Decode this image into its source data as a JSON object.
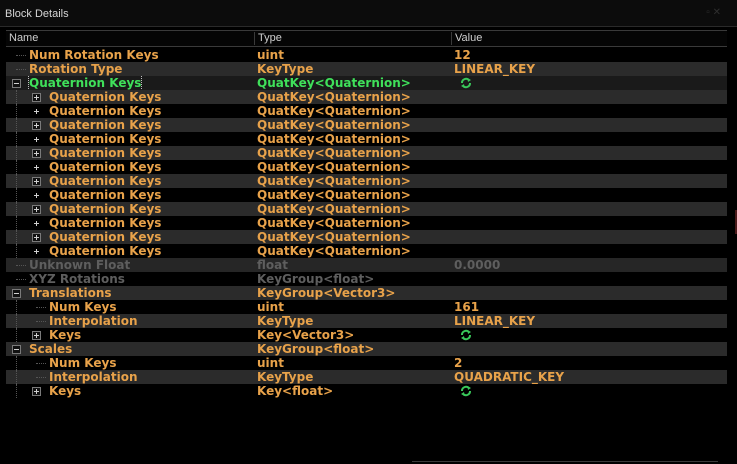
{
  "window": {
    "title": "Block Details",
    "controls": "▫ ✕"
  },
  "columns": {
    "name": "Name",
    "type": "Type",
    "value": "Value"
  },
  "rows": [
    {
      "name": "Num Rotation Keys",
      "type": "uint",
      "value": "12",
      "level": 0,
      "expander": "none",
      "style": "normal"
    },
    {
      "name": "Rotation Type",
      "type": "KeyType",
      "value": "LINEAR_KEY",
      "level": 0,
      "expander": "none",
      "style": "alt"
    },
    {
      "name": "Quaternion Keys",
      "type": "QuatKey<Quaternion>",
      "value": "",
      "valueIcon": "refresh-icon",
      "level": 0,
      "expander": "minus",
      "style": "selected-green"
    },
    {
      "name": "Quaternion Keys",
      "type": "QuatKey<Quaternion>",
      "value": "",
      "level": 1,
      "expander": "plus",
      "style": "alt"
    },
    {
      "name": "Quaternion Keys",
      "type": "QuatKey<Quaternion>",
      "value": "",
      "level": 1,
      "expander": "plus",
      "style": "normal"
    },
    {
      "name": "Quaternion Keys",
      "type": "QuatKey<Quaternion>",
      "value": "",
      "level": 1,
      "expander": "plus",
      "style": "alt"
    },
    {
      "name": "Quaternion Keys",
      "type": "QuatKey<Quaternion>",
      "value": "",
      "level": 1,
      "expander": "plus",
      "style": "normal"
    },
    {
      "name": "Quaternion Keys",
      "type": "QuatKey<Quaternion>",
      "value": "",
      "level": 1,
      "expander": "plus",
      "style": "alt"
    },
    {
      "name": "Quaternion Keys",
      "type": "QuatKey<Quaternion>",
      "value": "",
      "level": 1,
      "expander": "plus",
      "style": "normal"
    },
    {
      "name": "Quaternion Keys",
      "type": "QuatKey<Quaternion>",
      "value": "",
      "level": 1,
      "expander": "plus",
      "style": "alt"
    },
    {
      "name": "Quaternion Keys",
      "type": "QuatKey<Quaternion>",
      "value": "",
      "level": 1,
      "expander": "plus",
      "style": "normal"
    },
    {
      "name": "Quaternion Keys",
      "type": "QuatKey<Quaternion>",
      "value": "",
      "level": 1,
      "expander": "plus",
      "style": "alt"
    },
    {
      "name": "Quaternion Keys",
      "type": "QuatKey<Quaternion>",
      "value": "",
      "level": 1,
      "expander": "plus",
      "style": "normal"
    },
    {
      "name": "Quaternion Keys",
      "type": "QuatKey<Quaternion>",
      "value": "",
      "level": 1,
      "expander": "plus",
      "style": "alt"
    },
    {
      "name": "Quaternion Keys",
      "type": "QuatKey<Quaternion>",
      "value": "",
      "level": 1,
      "expander": "plus",
      "style": "normal"
    },
    {
      "name": "Unknown Float",
      "type": "float",
      "value": "0.0000",
      "level": 0,
      "expander": "none",
      "style": "gray-alt"
    },
    {
      "name": "XYZ Rotations",
      "type": "KeyGroup<float>",
      "value": "",
      "level": 0,
      "expander": "none",
      "style": "gray"
    },
    {
      "name": "Translations",
      "type": "KeyGroup<Vector3>",
      "value": "",
      "level": 0,
      "expander": "minus",
      "style": "alt"
    },
    {
      "name": "Num Keys",
      "type": "uint",
      "value": "161",
      "level": 1,
      "expander": "none",
      "style": "normal"
    },
    {
      "name": "Interpolation",
      "type": "KeyType",
      "value": "LINEAR_KEY",
      "level": 1,
      "expander": "none",
      "style": "alt"
    },
    {
      "name": "Keys",
      "type": "Key<Vector3>",
      "value": "",
      "valueIcon": "refresh-icon",
      "level": 1,
      "expander": "plus",
      "style": "normal"
    },
    {
      "name": "Scales",
      "type": "KeyGroup<float>",
      "value": "",
      "level": 0,
      "expander": "minus",
      "style": "alt"
    },
    {
      "name": "Num Keys",
      "type": "uint",
      "value": "2",
      "level": 1,
      "expander": "none",
      "style": "normal"
    },
    {
      "name": "Interpolation",
      "type": "KeyType",
      "value": "QUADRATIC_KEY",
      "level": 1,
      "expander": "none",
      "style": "alt"
    },
    {
      "name": "Keys",
      "type": "Key<float>",
      "value": "",
      "valueIcon": "refresh-icon",
      "level": 1,
      "expander": "plus",
      "style": "normal"
    }
  ],
  "colors": {
    "text": "#e8a24a",
    "selected": "#3fe05a",
    "disabled": "#5e5e5e",
    "rowAlt": "#2b2b2b",
    "background": "#000000"
  }
}
